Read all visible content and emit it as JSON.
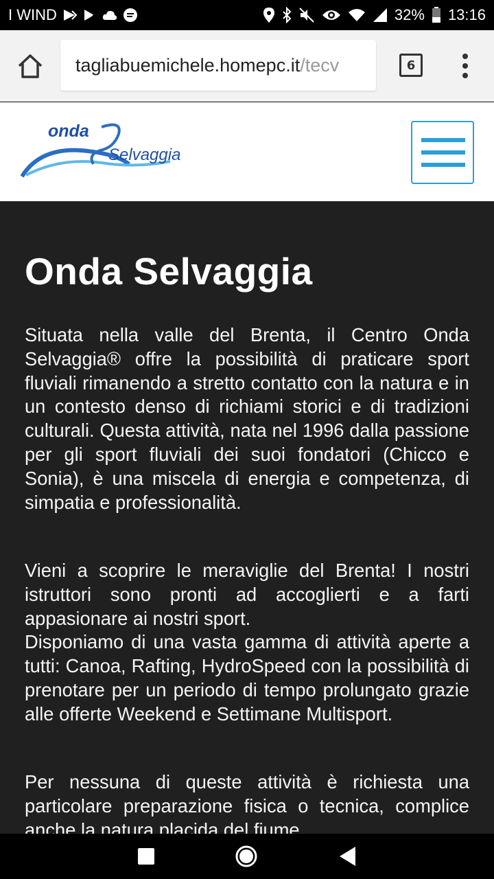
{
  "status_bar": {
    "carrier": "I WIND",
    "battery_percent": "32%",
    "time": "13:16"
  },
  "browser": {
    "url_domain": "tagliabuemichele.homepc.it",
    "url_path": "/tecv",
    "tab_count": "6"
  },
  "site": {
    "logo_text_1": "onda",
    "logo_text_2": "Selvaggia"
  },
  "main": {
    "title": "Onda Selvaggia",
    "paragraphs": [
      "Situata nella valle del Brenta, il Centro Onda Selvaggia® offre la possibilità di praticare sport fluviali rimanendo a stretto contatto con la natura e in un contesto denso di richiami storici e di tradizioni culturali. Questa attività, nata nel 1996 dalla passione per gli sport fluviali dei suoi fondatori (Chicco e Sonia), è una miscela di energia e competenza, di simpatia e professionalità.",
      "Vieni a scoprire le meraviglie del Brenta! I nostri istruttori sono pronti ad accoglierti e a farti appasionare ai nostri sport.",
      "Disponiamo di una vasta gamma di attività aperte a tutti: Canoa, Rafting, HydroSpeed con la possibilità di prenotare per un periodo di tempo prolungato grazie alle offerte Weekend e Settimane Multisport.",
      "Per nessuna di queste attività è richiesta una particolare preparazione fisica o tecnica, complice anche la natura placida del fiume"
    ]
  },
  "colors": {
    "accent": "#2a9fd8",
    "content_bg": "#202020"
  }
}
